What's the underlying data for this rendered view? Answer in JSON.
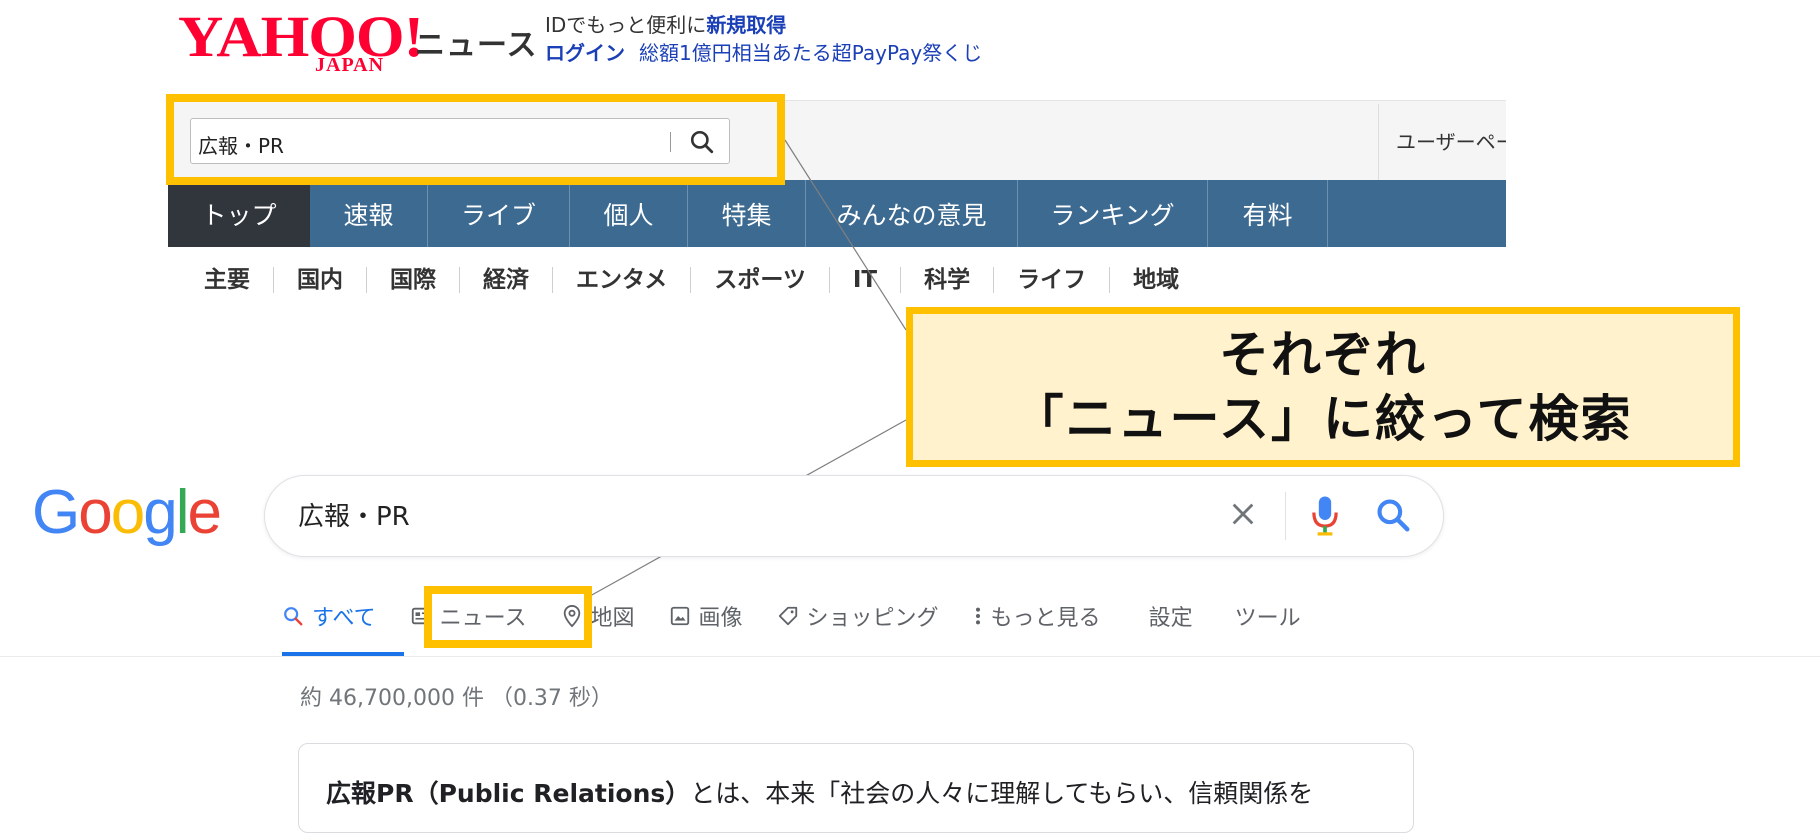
{
  "yahoo": {
    "logo_main": "YAHOO!",
    "logo_sub": "JAPAN",
    "section_label": "ニュース",
    "promo_line1_prefix": "IDでもっと便利に",
    "promo_line1_link": "新規取得",
    "login_link": "ログイン",
    "promo_link": "総額1億円相当あたる超PayPay祭くじ",
    "search_value": "広報・PR",
    "user_page_link": "ユーザーペー",
    "tabs": [
      "トップ",
      "速報",
      "ライブ",
      "個人",
      "特集",
      "みんなの意見",
      "ランキング",
      "有料"
    ],
    "categories": [
      "主要",
      "国内",
      "国際",
      "経済",
      "エンタメ",
      "スポーツ",
      "IT",
      "科学",
      "ライフ",
      "地域"
    ]
  },
  "callout": {
    "line1": "それぞれ",
    "line2": "「ニュース」に絞って検索",
    "highlight_color": "#ffc000",
    "fill_color": "#fff2cc"
  },
  "google": {
    "search_value": "広報・PR",
    "tabs": {
      "all": "すべて",
      "news": "ニュース",
      "maps": "地図",
      "images": "画像",
      "shopping": "ショッピング",
      "more": "もっと見る",
      "settings": "設定",
      "tools": "ツール"
    },
    "result_stats": "約 46,700,000 件 （0.37 秒）",
    "snippet_bold": "広報PR",
    "snippet_paren": "（Public Relations）",
    "snippet_rest": "とは、本来「社会の人々に理解してもらい、信頼関係を"
  },
  "colors": {
    "yahoo_red": "#ff0033",
    "yahoo_nav": "#3d6a91",
    "yahoo_nav_active": "#31353c",
    "google_blue": "#1a73e8"
  }
}
